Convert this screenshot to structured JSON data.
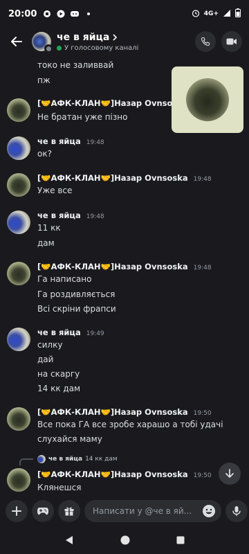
{
  "status": {
    "time": "20:00",
    "network": "4G+"
  },
  "header": {
    "title": "че в яйца",
    "subtitle": "У голосовому каналі"
  },
  "messages": [
    {
      "lines": [
        "токо не заливвай",
        "пж"
      ]
    },
    {
      "author": "[🤝АФК-КЛАН🤝]Назар Ovnsoska",
      "time": "",
      "lines": [
        "Не братан уже пізно"
      ]
    },
    {
      "author": "че в яйца",
      "time": "19:48",
      "lines": [
        "ок?"
      ]
    },
    {
      "author": "[🤝АФК-КЛАН🤝]Назар Ovnsoska",
      "time": "19:48",
      "lines": [
        "Уже все"
      ]
    },
    {
      "author": "че в яйца",
      "time": "19:48",
      "lines": [
        "11 кк",
        "дам"
      ]
    },
    {
      "author": "[🤝АФК-КЛАН🤝]Назар Ovnsoska",
      "time": "19:48",
      "lines": [
        "Га написано",
        "Га роздивляється",
        "Всі скріни фрапси"
      ]
    },
    {
      "author": "че в яйца",
      "time": "19:49",
      "lines": [
        "силку",
        "дай",
        "на скаргу",
        "14 кк дам"
      ]
    },
    {
      "author": "[🤝АФК-КЛАН🤝]Назар Ovnsoska",
      "time": "19:50",
      "lines": [
        "Все пока  ГА все зробе харашо а тобі удачі",
        "слухайся маму"
      ]
    },
    {
      "author": "[🤝АФК-КЛАН🤝]Назар Ovnsoska",
      "time": "19:50",
      "lines": [
        "Клянешся"
      ],
      "reply": {
        "author": "че в яйца",
        "text": "14 кк дам"
      }
    }
  ],
  "composer": {
    "placeholder": "Написати у @че в яй..."
  },
  "icons": {
    "accent": "#23a55a",
    "background": "#1a1a1e"
  }
}
